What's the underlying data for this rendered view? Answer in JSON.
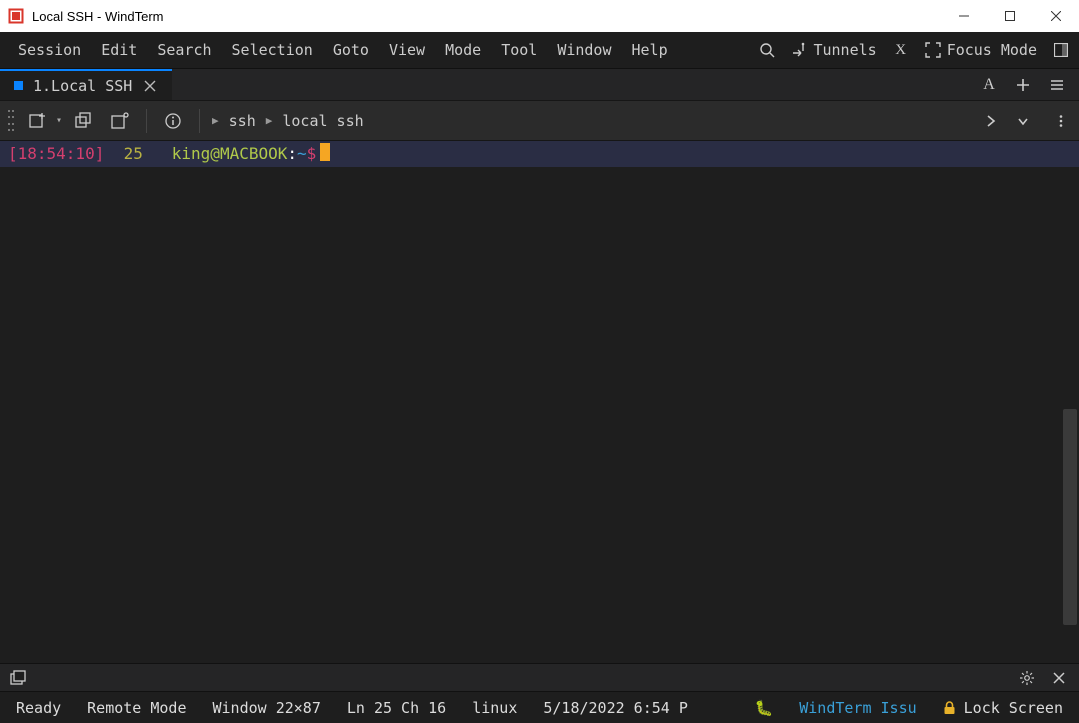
{
  "titlebar": {
    "title": "Local SSH - WindTerm"
  },
  "menubar": {
    "items": [
      "Session",
      "Edit",
      "Search",
      "Selection",
      "Goto",
      "View",
      "Mode",
      "Tool",
      "Window",
      "Help"
    ],
    "tunnels_label": "Tunnels",
    "focus_mode_label": "Focus Mode"
  },
  "tabs": {
    "active": {
      "label": "1.Local SSH"
    }
  },
  "toolbar": {
    "breadcrumb": [
      "ssh",
      "local ssh"
    ]
  },
  "terminal": {
    "timestamp": "[18:54:10]",
    "line_number": "25",
    "user": "king",
    "host": "MACBOOK",
    "path": "~",
    "prompt_sym": "$"
  },
  "status": {
    "ready": "Ready",
    "remote_mode": "Remote Mode",
    "window_dims": "Window 22×87",
    "caret": "Ln 25 Ch 16",
    "os": "linux",
    "datetime": "5/18/2022 6:54 P",
    "link_label": "WindTerm Issu",
    "lock_label": "Lock Screen"
  }
}
